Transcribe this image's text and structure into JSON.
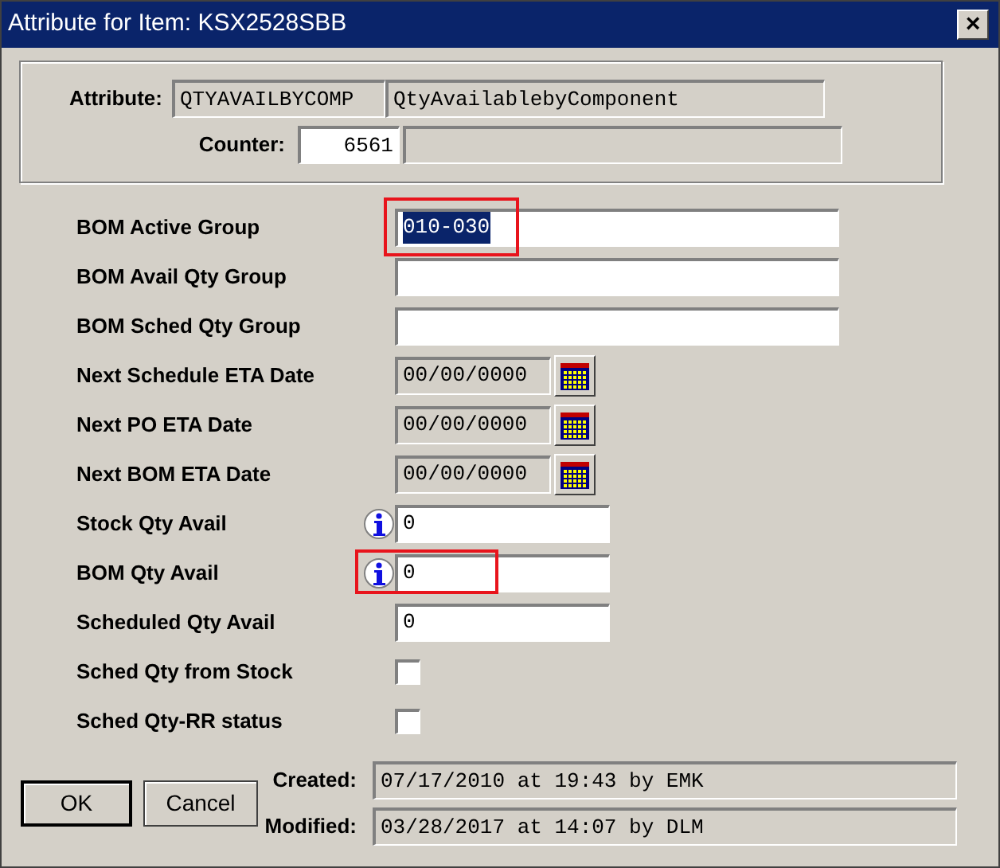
{
  "window": {
    "title": "Attribute for Item: KSX2528SBB",
    "close": "×"
  },
  "attribute": {
    "label": "Attribute:",
    "code": "QTYAVAILBYCOMP",
    "description": "QtyAvailablebyComponent"
  },
  "counter": {
    "label": "Counter:",
    "value": "6561"
  },
  "fields": [
    {
      "kind": "text",
      "label": "BOM Active Group",
      "value": "010-030",
      "text_selected": true,
      "highlighted": true
    },
    {
      "kind": "text",
      "label": "BOM Avail Qty Group",
      "highlighted": false
    },
    {
      "kind": "text",
      "label": "BOM Sched Qty Group",
      "highlighted": false
    },
    {
      "kind": "date",
      "label": "Next Schedule ETA Date",
      "value": "00/00/0000",
      "highlighted": false
    },
    {
      "kind": "date",
      "label": "Next PO ETA Date",
      "value": "00/00/0000",
      "highlighted": false
    },
    {
      "kind": "date",
      "label": "Next BOM ETA Date",
      "value": "00/00/0000",
      "highlighted": false
    },
    {
      "kind": "qty",
      "label": "Stock Qty Avail",
      "value": "0",
      "info": true,
      "highlighted": false
    },
    {
      "kind": "qty",
      "label": "BOM Qty Avail",
      "value": "0",
      "info": true,
      "highlighted": true
    },
    {
      "kind": "qty",
      "label": "Scheduled Qty Avail",
      "value": "0",
      "info": false,
      "highlighted": false
    },
    {
      "kind": "checkbox",
      "label": "Sched Qty from Stock",
      "checked": false,
      "highlighted": false
    },
    {
      "kind": "checkbox",
      "label": "Sched Qty-RR status",
      "checked": false,
      "highlighted": false
    }
  ],
  "buttons": [
    "OK",
    "Cancel"
  ],
  "audit": [
    {
      "label": "Created:",
      "value": "07/17/2010 at 19:43 by EMK"
    },
    {
      "label": "Modified:",
      "value": "03/28/2017 at 14:07 by DLM"
    }
  ]
}
